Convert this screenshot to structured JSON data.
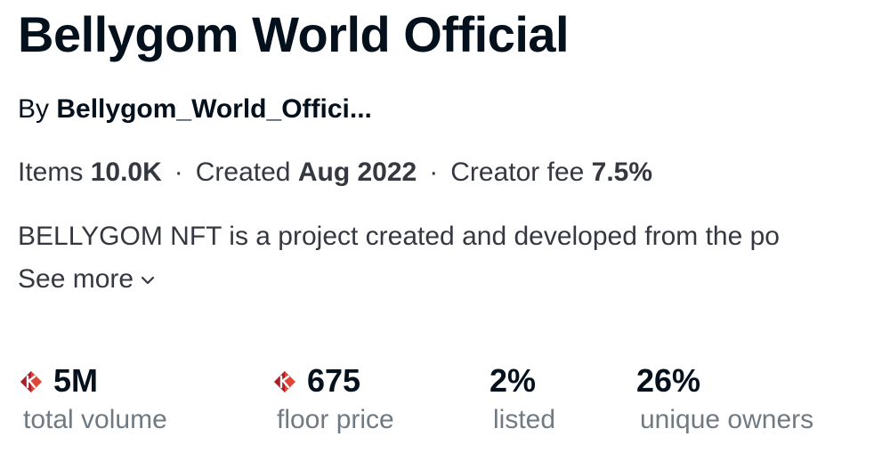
{
  "collection": {
    "title": "Bellygom World Official",
    "by_prefix": "By",
    "creator": "Bellygom_World_Offici...",
    "description": "BELLYGOM NFT is a project created and developed from the po",
    "see_more_label": "See more"
  },
  "meta": {
    "items_label": "Items",
    "items_value": "10.0K",
    "created_label": "Created",
    "created_value": "Aug 2022",
    "fee_label": "Creator fee",
    "fee_value": "7.5%",
    "separator": "·"
  },
  "stats": {
    "volume": {
      "value": "5M",
      "label": "total volume",
      "icon": "klay-coin-icon"
    },
    "floor": {
      "value": "675",
      "label": "floor price",
      "icon": "klay-coin-icon"
    },
    "listed": {
      "value": "2%",
      "label": "listed"
    },
    "owners": {
      "value": "26%",
      "label": "unique owners"
    }
  },
  "colors": {
    "heading": "#04111d",
    "body_text": "#353840",
    "muted_text": "#707a83",
    "coin_red": "#e0453a",
    "coin_dark": "#a81f2a"
  }
}
